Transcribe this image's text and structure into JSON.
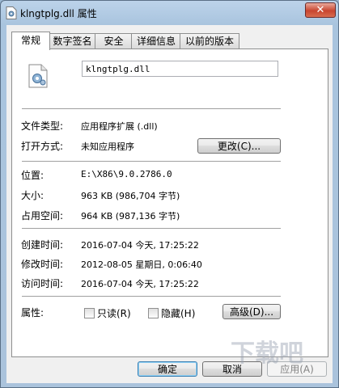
{
  "window": {
    "title": "klngtplg.dll 属性",
    "close_label": "✕"
  },
  "tabs": [
    {
      "label": "常规",
      "active": true
    },
    {
      "label": "数字签名",
      "active": false
    },
    {
      "label": "安全",
      "active": false
    },
    {
      "label": "详细信息",
      "active": false
    },
    {
      "label": "以前的版本",
      "active": false
    }
  ],
  "general": {
    "file_name": "klngtplg.dll",
    "file_type_label": "文件类型:",
    "file_type_value": "应用程序扩展 (.dll)",
    "open_with_label": "打开方式:",
    "open_with_value": "未知应用程序",
    "change_button": "更改(C)...",
    "location_label": "位置:",
    "location_value": "E:\\X86\\9.0.2786.0",
    "size_label": "大小:",
    "size_value": "963 KB (986,704 字节)",
    "size_on_disk_label": "占用空间:",
    "size_on_disk_value": "964 KB (987,136 字节)",
    "created_label": "创建时间:",
    "created_value": "2016-07-04 今天, 17:25:22",
    "modified_label": "修改时间:",
    "modified_value": "2012-08-05 星期日, 0:06:40",
    "accessed_label": "访问时间:",
    "accessed_value": "2016-07-04 今天, 17:25:22",
    "attributes_label": "属性:",
    "readonly_label": "只读(R)",
    "readonly_checked": false,
    "hidden_label": "隐藏(H)",
    "hidden_checked": false,
    "advanced_button": "高级(D)..."
  },
  "footer": {
    "ok_button": "确定",
    "cancel_button": "取消",
    "apply_button": "应用(A)"
  },
  "watermark": "下载吧",
  "colors": {
    "title_bar": "#a9c4de",
    "close_button": "#c8452f",
    "dialog_bg": "#f0f0f0",
    "default_button_border": "#3c7fb1"
  }
}
